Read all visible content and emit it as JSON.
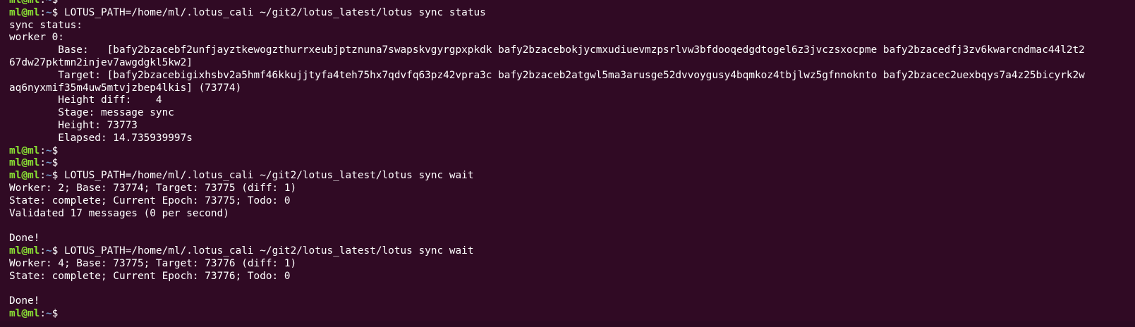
{
  "terminal": {
    "prompt": {
      "user_host": "ml@ml",
      "colon": ":",
      "path": "~",
      "symbol": "$ "
    },
    "lines": [
      {
        "type": "prompt",
        "command": ""
      },
      {
        "type": "prompt",
        "command": "LOTUS_PATH=/home/ml/.lotus_cali ~/git2/lotus_latest/lotus sync status"
      },
      {
        "type": "output",
        "text": "sync status:"
      },
      {
        "type": "output",
        "text": "worker 0:"
      },
      {
        "type": "output",
        "text": "        Base:   [bafy2bzacebf2unfjayztkewogzthurrxeubjptznuna7swapskvgyrgpxpkdk bafy2bzacebokjycmxudiuevmzpsrlvw3bfdooqedgdtogel6z3jvczsxocpme bafy2bzacedfj3zv6kwarcndmac44l2t2"
      },
      {
        "type": "output",
        "text": "67dw27pktmn2injev7awgdgkl5kw2]"
      },
      {
        "type": "output",
        "text": "        Target: [bafy2bzacebigixhsbv2a5hmf46kkujjtyfa4teh75hx7qdvfq63pz42vpra3c bafy2bzaceb2atgwl5ma3arusge52dvvoygusy4bqmkoz4tbjlwz5gfnnoknto bafy2bzacec2uexbqys7a4z25bicyrk2w"
      },
      {
        "type": "output",
        "text": "aq6nyxmif35m4uw5mtvjzbep4lkis] (73774)"
      },
      {
        "type": "output",
        "text": "        Height diff:    4"
      },
      {
        "type": "output",
        "text": "        Stage: message sync"
      },
      {
        "type": "output",
        "text": "        Height: 73773"
      },
      {
        "type": "output",
        "text": "        Elapsed: 14.735939997s"
      },
      {
        "type": "prompt",
        "command": ""
      },
      {
        "type": "prompt",
        "command": ""
      },
      {
        "type": "prompt",
        "command": "LOTUS_PATH=/home/ml/.lotus_cali ~/git2/lotus_latest/lotus sync wait"
      },
      {
        "type": "output",
        "text": "Worker: 2; Base: 73774; Target: 73775 (diff: 1)"
      },
      {
        "type": "output",
        "text": "State: complete; Current Epoch: 73775; Todo: 0"
      },
      {
        "type": "output",
        "text": "Validated 17 messages (0 per second)"
      },
      {
        "type": "output",
        "text": ""
      },
      {
        "type": "output",
        "text": "Done!"
      },
      {
        "type": "prompt",
        "command": "LOTUS_PATH=/home/ml/.lotus_cali ~/git2/lotus_latest/lotus sync wait"
      },
      {
        "type": "output",
        "text": "Worker: 4; Base: 73775; Target: 73776 (diff: 1)"
      },
      {
        "type": "output",
        "text": "State: complete; Current Epoch: 73776; Todo: 0"
      },
      {
        "type": "output",
        "text": ""
      },
      {
        "type": "output",
        "text": "Done!"
      },
      {
        "type": "prompt",
        "command": ""
      }
    ]
  },
  "colors": {
    "background": "#300a24",
    "prompt_user": "#8ae234",
    "prompt_path": "#729fcf",
    "text": "#ffffff"
  }
}
